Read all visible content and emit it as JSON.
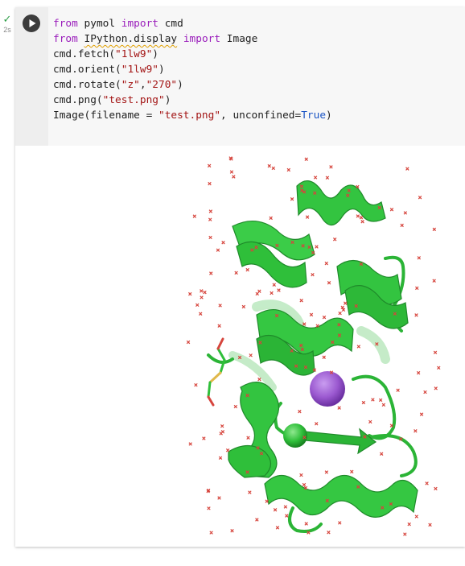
{
  "exec": {
    "status_icon": "check-icon",
    "duration": "2s",
    "status_color": "#2e9e48"
  },
  "cell": {
    "run_icon": "play-icon",
    "lines": [
      {
        "parts": [
          {
            "t": "from",
            "k": "kw"
          },
          {
            "t": " pymol ",
            "k": ""
          },
          {
            "t": "import",
            "k": "kw"
          },
          {
            "t": " cmd",
            "k": ""
          }
        ]
      },
      {
        "parts": [
          {
            "t": "from",
            "k": "kw"
          },
          {
            "t": " ",
            "k": ""
          },
          {
            "t": "IPython.display",
            "k": "squig"
          },
          {
            "t": " ",
            "k": ""
          },
          {
            "t": "import",
            "k": "kw"
          },
          {
            "t": " Image",
            "k": ""
          }
        ]
      },
      {
        "parts": [
          {
            "t": "cmd.fetch(",
            "k": ""
          },
          {
            "t": "\"1lw9\"",
            "k": "str"
          },
          {
            "t": ")",
            "k": ""
          }
        ]
      },
      {
        "parts": [
          {
            "t": "cmd.orient(",
            "k": ""
          },
          {
            "t": "\"1lw9\"",
            "k": "str"
          },
          {
            "t": ")",
            "k": ""
          }
        ]
      },
      {
        "parts": [
          {
            "t": "cmd.rotate(",
            "k": ""
          },
          {
            "t": "\"z\"",
            "k": "str"
          },
          {
            "t": ",",
            "k": ""
          },
          {
            "t": "\"270\"",
            "k": "str"
          },
          {
            "t": ")",
            "k": ""
          }
        ]
      },
      {
        "parts": [
          {
            "t": "cmd.png(",
            "k": ""
          },
          {
            "t": "\"test.png\"",
            "k": "str"
          },
          {
            "t": ")",
            "k": ""
          }
        ]
      },
      {
        "parts": [
          {
            "t": "Image(filename = ",
            "k": ""
          },
          {
            "t": "\"test.png\"",
            "k": "str"
          },
          {
            "t": ", unconfined=",
            "k": ""
          },
          {
            "t": "True",
            "k": "bool"
          },
          {
            "t": ")",
            "k": ""
          }
        ]
      }
    ]
  },
  "output": {
    "image_name": "protein-structure-image",
    "colors": {
      "helix": "#33c440",
      "helix_dark": "#1f8a2a",
      "water": "#d6453d",
      "ion_purple": "#9b59d0",
      "ion_green": "#2fbf3a",
      "ligand": "#e0b84a"
    }
  }
}
